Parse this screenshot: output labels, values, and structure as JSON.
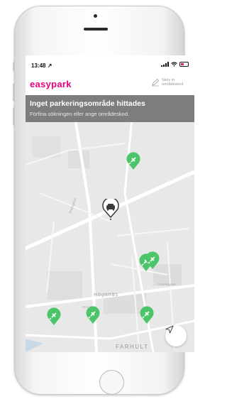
{
  "status_bar": {
    "time": "13:48",
    "location_icon": "location-arrow-icon",
    "signal_icon": "cellular-signal-icon",
    "wifi_icon": "wifi-icon",
    "battery_icon": "battery-icon"
  },
  "app": {
    "logo_text": "easypark",
    "brand_color": "#e6007e",
    "signin": {
      "icon": "pencil-icon",
      "label": "Skriv in områdeskod"
    }
  },
  "banner": {
    "title": "Inget parkeringsområde hittades",
    "subtitle": "Förfina sökningen eller ange områdeskod.",
    "background": "#7d7d7d"
  },
  "map": {
    "labels": {
      "area": "Höganäs",
      "district": "FARHULT"
    },
    "street_labels": {
      "s1": "Bruksgatan",
      "s2": "Centralgatan",
      "s3": "Storgatan"
    },
    "markers": {
      "parking_color": "#4cc56a",
      "parking_icon": "ev-charging-plug-icon",
      "current_location_icon": "car-icon"
    },
    "nav_button_icon": "navigation-arrow-icon"
  }
}
